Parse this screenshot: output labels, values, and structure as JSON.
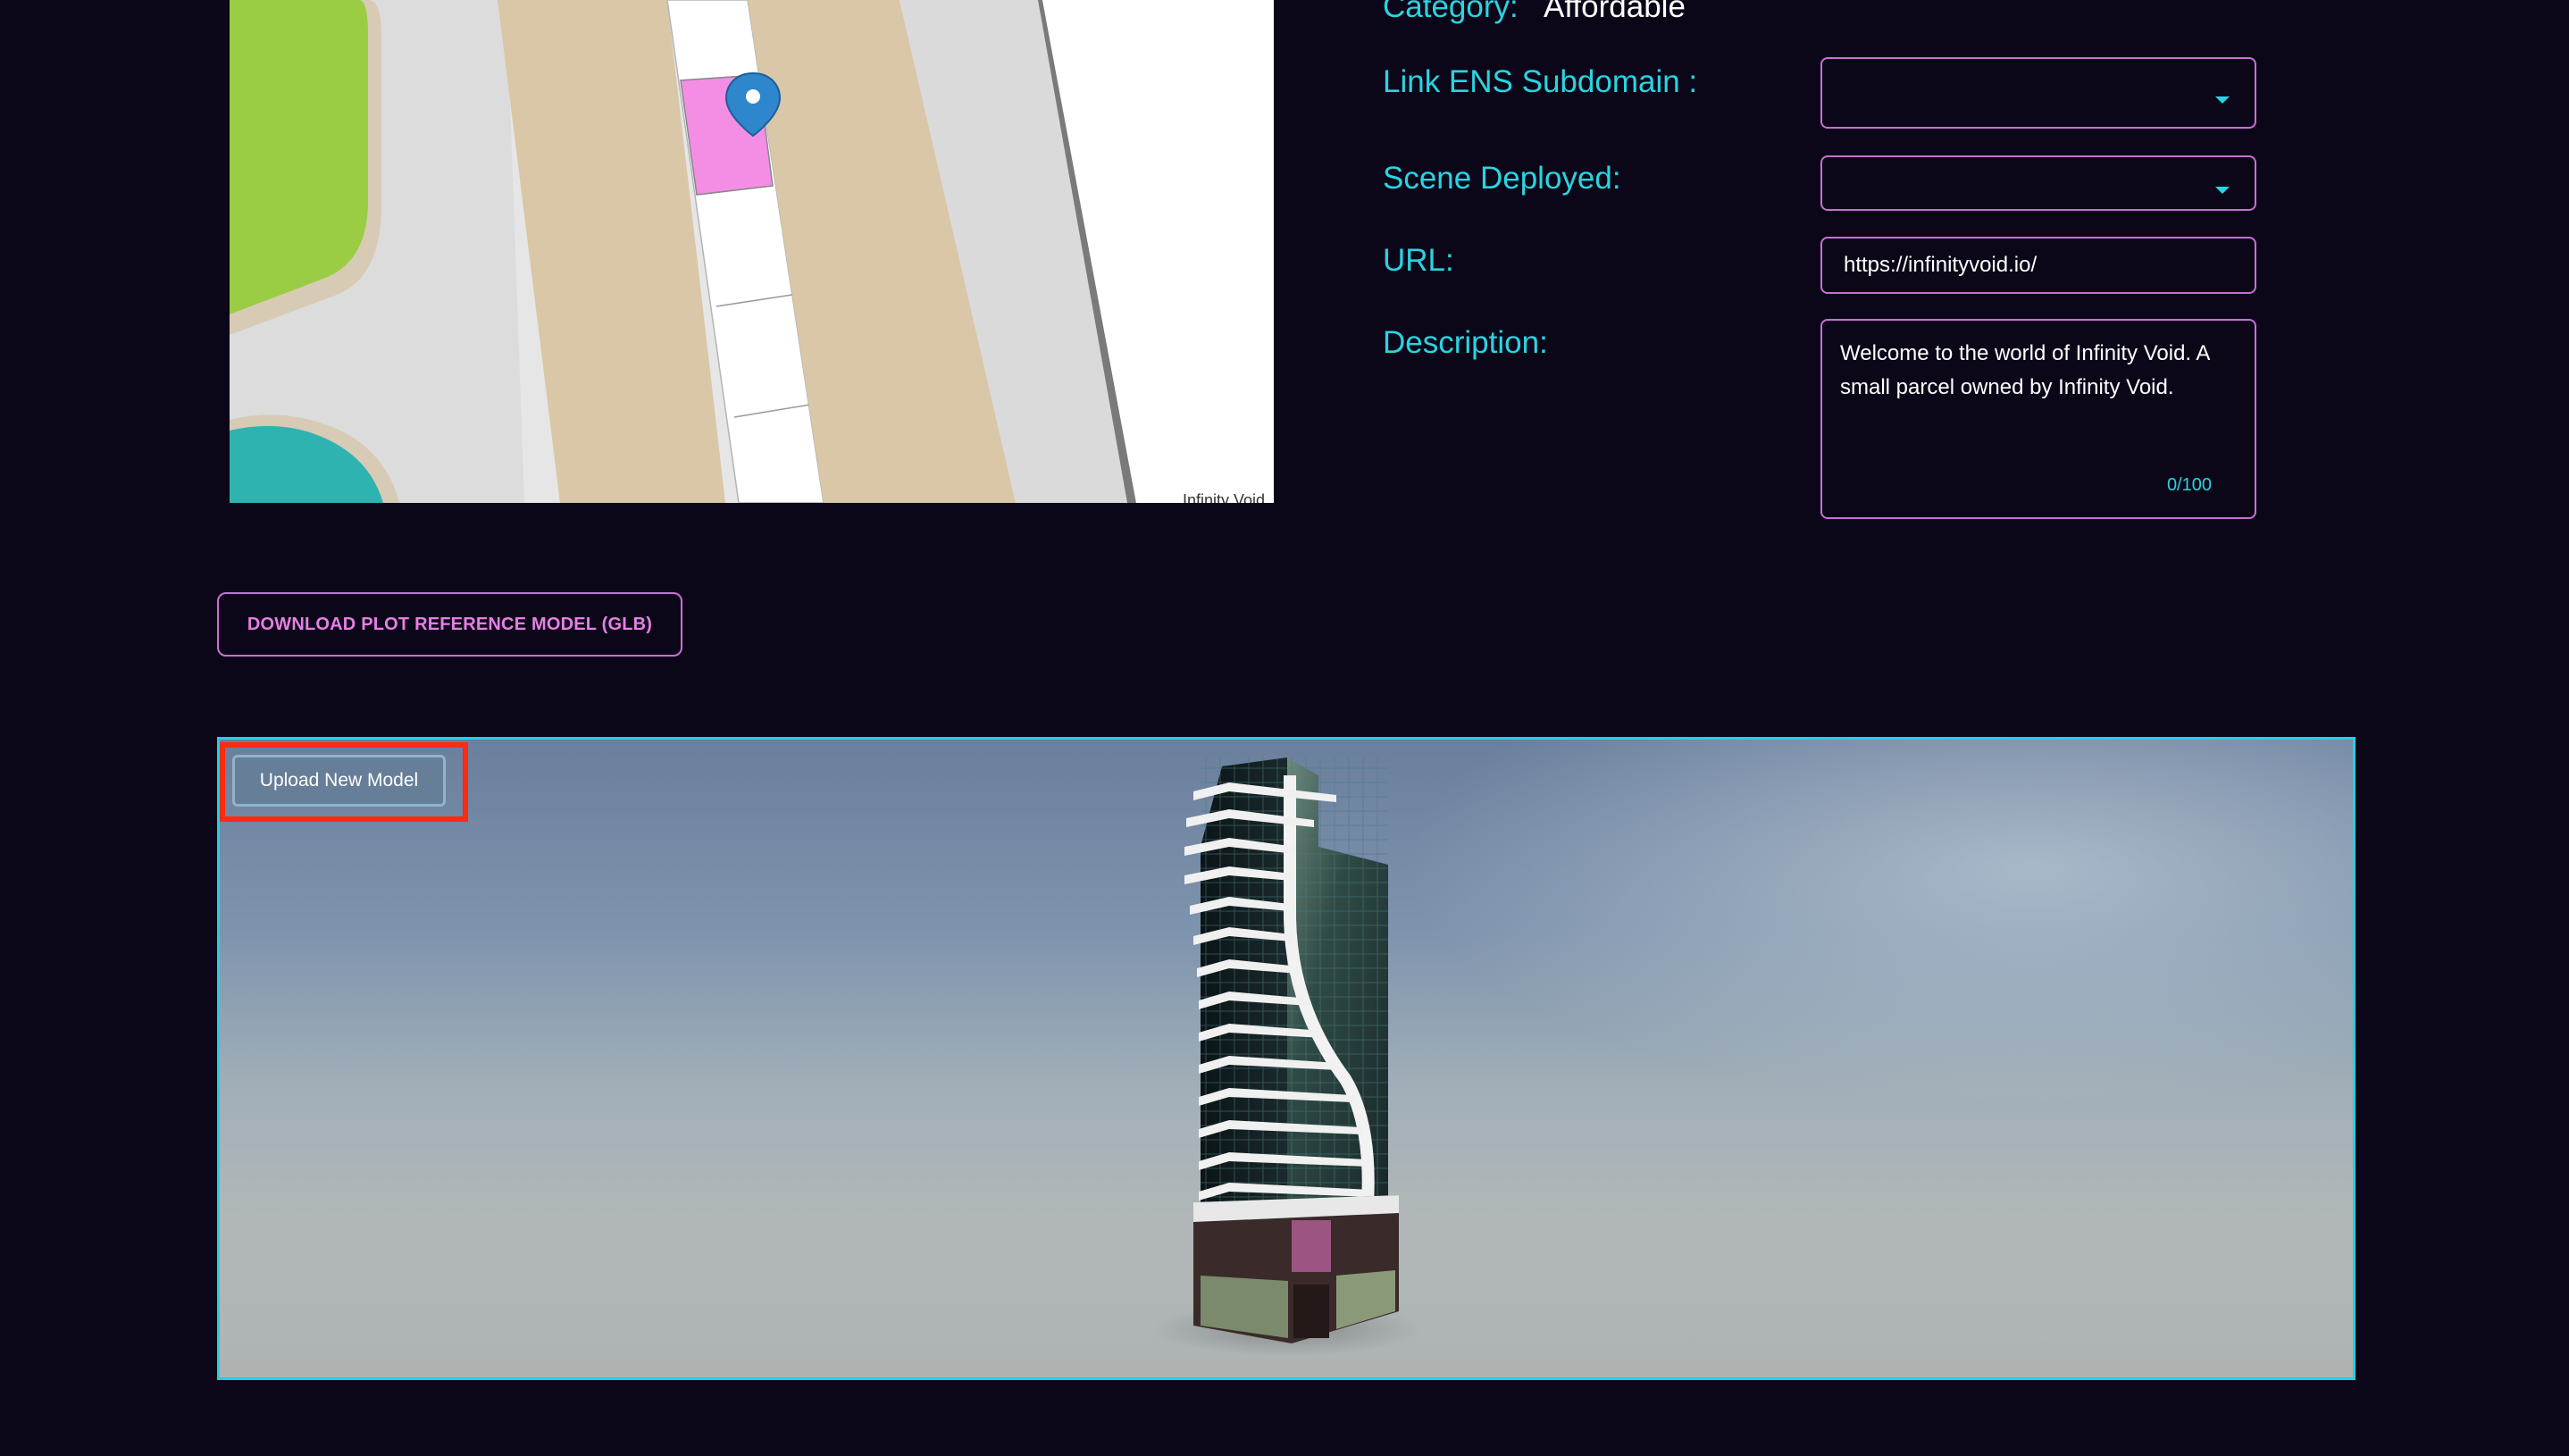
{
  "form": {
    "category_label": "Category:",
    "category_value": "Affordable",
    "ens_label": "Link ENS Subdomain :",
    "ens_value": "",
    "scene_label": "Scene Deployed:",
    "scene_value": "",
    "url_label": "URL:",
    "url_value": "https://infinityvoid.io/",
    "description_label": "Description:",
    "description_value": "Welcome to the world of Infinity Void. A small parcel owned by Infinity Void.",
    "description_count": "0/100"
  },
  "map": {
    "attribution": "Infinity Void",
    "marker_icon": "map-pin-icon",
    "selected_parcel_color": "#f48ee4"
  },
  "actions": {
    "download_label": "DOWNLOAD PLOT REFERENCE MODEL (GLB)",
    "upload_label": "Upload New Model"
  },
  "colors": {
    "background": "#0b0719",
    "label": "#2ad4e0",
    "border_accent": "#c970d2",
    "viewer_border": "#1fd2e2",
    "highlight": "#ff2a12"
  }
}
